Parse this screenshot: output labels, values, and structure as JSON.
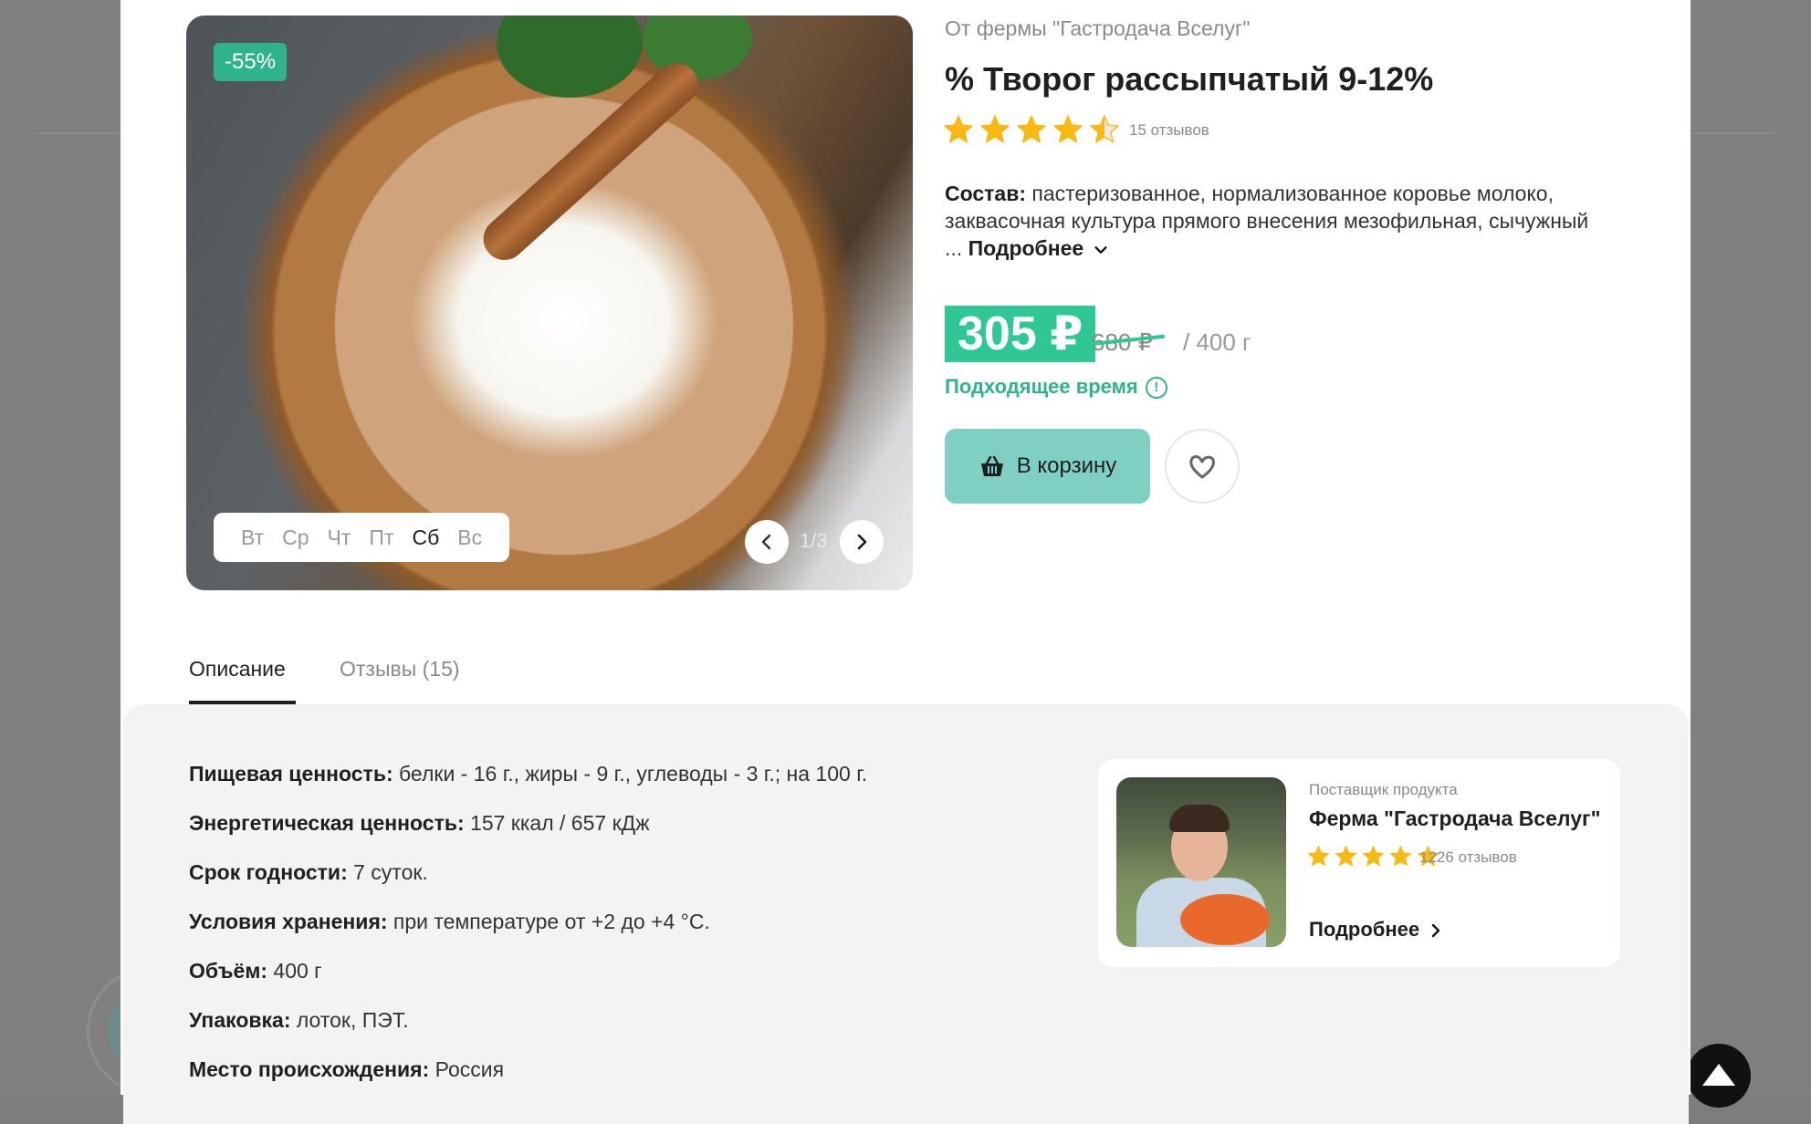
{
  "product": {
    "farm_from": "От фермы \"Гастродача Вселуг\"",
    "title": "% Творог рассыпчатый 9-12%",
    "rating": 4.5,
    "reviews_label": "15 отзывов",
    "composition_label": "Состав:",
    "composition_text": " пастеризованное, нормализованное коровье молоко, заквасочная культура прямого внесения мезофильная, сычужный ... ",
    "more_label": "Подробнее",
    "price_new": "305 ₽",
    "price_old": "680 ₽",
    "unit": "/ 400 г",
    "time_label": "Подходящее время",
    "time_info": "!",
    "cart_label": "В корзину"
  },
  "gallery": {
    "discount": "-55%",
    "days": [
      "Вт",
      "Ср",
      "Чт",
      "Пт",
      "Сб",
      "Вс"
    ],
    "active_day": "Сб",
    "counter": "1/3"
  },
  "tabs": {
    "description": "Описание",
    "reviews": "Отзывы (15)"
  },
  "specs": [
    {
      "label": "Пищевая ценность:",
      "value": " белки - 16 г., жиры - 9 г., углеводы - 3 г.; на 100 г."
    },
    {
      "label": "Энергетическая ценность:",
      "value": " 157 ккал / 657 кДж"
    },
    {
      "label": "Срок годности:",
      "value": " 7 суток."
    },
    {
      "label": "Условия хранения:",
      "value": " при температуре от +2 до +4 °С."
    },
    {
      "label": "Объём:",
      "value": " 400 г"
    },
    {
      "label": "Упаковка:",
      "value": " лоток, ПЭТ."
    },
    {
      "label": "Место происхождения:",
      "value": " Россия"
    }
  ],
  "supplier": {
    "label": "Поставщик продукта",
    "name": "Ферма \"Гастродача Вселуг\"",
    "rating": 5,
    "reviews_label": "1226 отзывов",
    "more_label": "Подробнее"
  },
  "colors": {
    "accent": "#2fc794",
    "star": "#f8b912",
    "cart": "#7fcfc3"
  }
}
